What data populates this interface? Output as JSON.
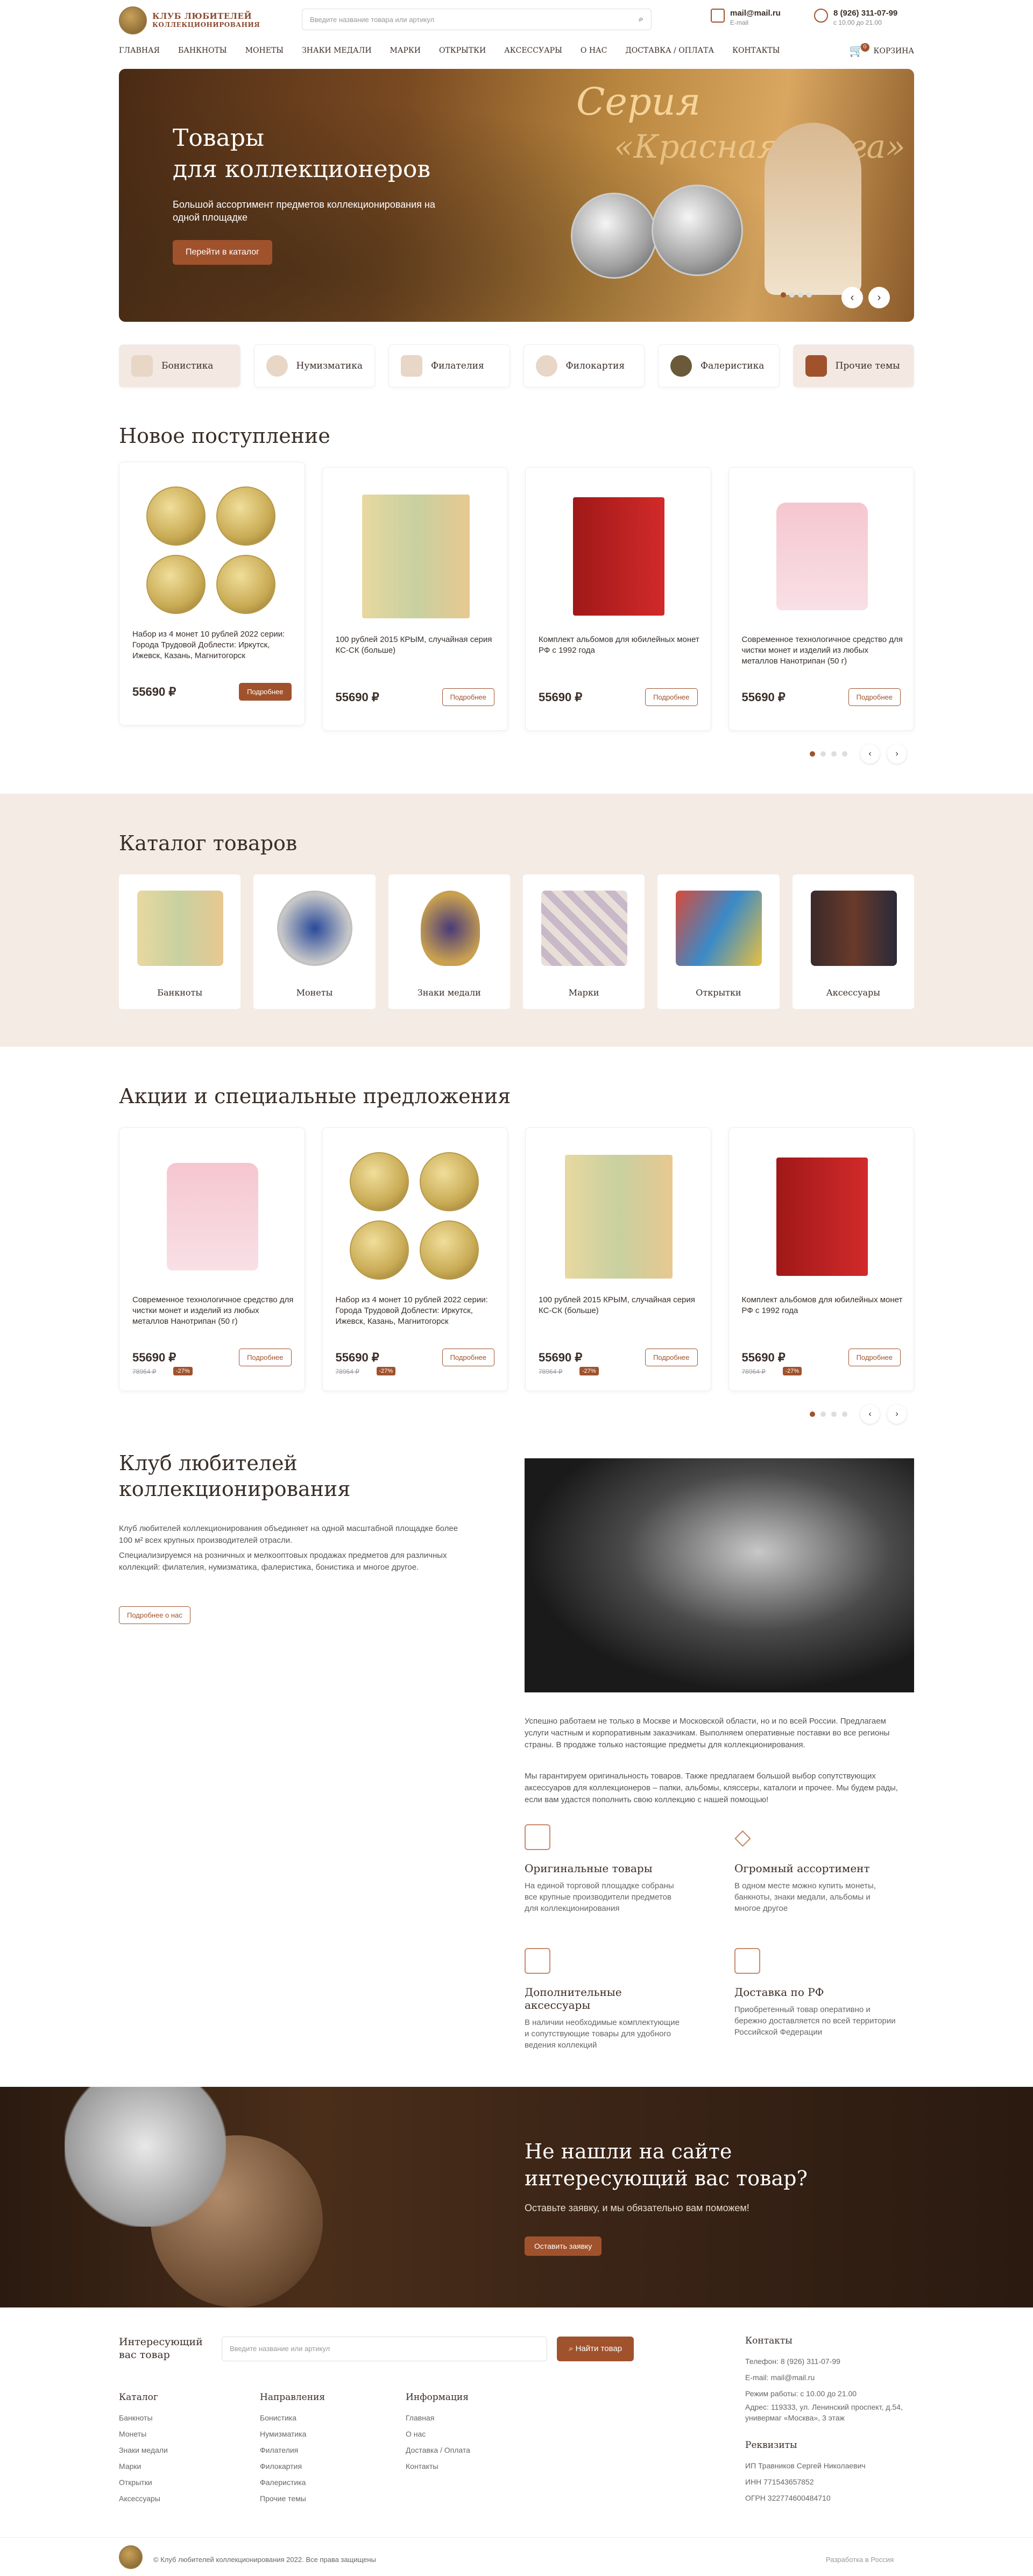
{
  "header": {
    "logo_line1": "КЛУБ ЛЮБИТЕЛЕЙ",
    "logo_line2": "КОЛЛЕКЦИОНИРОВАНИЯ",
    "search_placeholder": "Введите название товара или артикул",
    "email": "mail@mail.ru",
    "email_label": "E-mail",
    "phone": "8 (926) 311-07-99",
    "hours": "с 10.00 до 21.00",
    "cart_label": "КОРЗИНА",
    "cart_count": "0"
  },
  "nav": [
    "ГЛАВНАЯ",
    "БАНКНОТЫ",
    "МОНЕТЫ",
    "ЗНАКИ МЕДАЛИ",
    "МАРКИ",
    "ОТКРЫТКИ",
    "АКСЕССУАРЫ",
    "О НАС",
    "ДОСТАВКА / ОПЛАТА",
    "КОНТАКТЫ"
  ],
  "hero": {
    "title_line1": "Товары",
    "title_line2": "для коллекционеров",
    "subtitle": "Большой ассортимент предметов коллекционирования на одной площадке",
    "button": "Перейти в каталог",
    "overlay1": "Серия",
    "overlay2": "«Красная книга»"
  },
  "tabs": [
    "Бонистика",
    "Нумизматика",
    "Филателия",
    "Филокартия",
    "Фалеристика",
    "Прочие темы"
  ],
  "new_arrivals": {
    "title": "Новое поступление",
    "items": [
      {
        "title": "Набор из 4 монет 10 рублей 2022 серии: Города Трудовой Доблести: Иркутск, Ижевск, Казань, Магнитогорск",
        "price": "55690 ₽",
        "button": "Подробнее"
      },
      {
        "title": "100 рублей 2015 КРЫМ, случайная серия КС-СК (больше)",
        "price": "55690 ₽",
        "button": "Подробнее"
      },
      {
        "title": "Комплект альбомов для юбилейных монет РФ с 1992 года",
        "price": "55690 ₽",
        "button": "Подробнее"
      },
      {
        "title": "Современное технологичное средство для чистки монет и изделий из любых металлов Нанотрипан (50 г)",
        "price": "55690 ₽",
        "button": "Подробнее"
      }
    ]
  },
  "catalog": {
    "title": "Каталог товаров",
    "items": [
      "Банкноты",
      "Монеты",
      "Знаки медали",
      "Марки",
      "Открытки",
      "Аксессуары"
    ]
  },
  "promo": {
    "title": "Акции и специальные предложения",
    "items": [
      {
        "title": "Современное технологичное средство для чистки монет и изделий из любых металлов Нанотрипан (50 г)",
        "price": "55690 ₽",
        "old": "78964 ₽",
        "disc": "-27%",
        "button": "Подробнее"
      },
      {
        "title": "Набор из 4 монет 10 рублей 2022 серии: Города Трудовой Доблести: Иркутск, Ижевск, Казань, Магнитогорск",
        "price": "55690 ₽",
        "old": "78964 ₽",
        "disc": "-27%",
        "button": "Подробнее"
      },
      {
        "title": "100 рублей 2015 КРЫМ, случайная серия КС-СК (больше)",
        "price": "55690 ₽",
        "old": "78964 ₽",
        "disc": "-27%",
        "button": "Подробнее"
      },
      {
        "title": "Комплект альбомов для юбилейных монет РФ с 1992 года",
        "price": "55690 ₽",
        "old": "78964 ₽",
        "disc": "-27%",
        "button": "Подробнее"
      }
    ]
  },
  "club": {
    "title_line1": "Клуб любителей",
    "title_line2": "коллекционирования",
    "p1": "Клуб любителей коллекционирования объединяет на одной масштабной площадке более 100 м² всех крупных производителей отрасли.",
    "p2": "Специализируемся на розничных и мелкооптовых продажах предметов для различных коллекций: филателия, нумизматика, фалеристика, бонистика и многое другое.",
    "button": "Подробнее о нас",
    "p3": "Успешно работаем не только в Москве и Московской области, но и по всей России. Предлагаем услуги частным и корпоративным заказчикам. Выполняем оперативные поставки во все регионы страны. В продаже только настоящие предметы для коллекционирования.",
    "p4": "Мы гарантируем оригинальность товаров. Также предлагаем большой выбор сопутствующих аксессуаров для коллекционеров – папки, альбомы, кляссеры, каталоги и прочее. Мы будем рады, если вам удастся пополнить свою коллекцию с нашей помощью!",
    "features": [
      {
        "title": "Оригинальные товары",
        "text": "На единой торговой площадке собраны все крупные производители предметов для коллекционирования"
      },
      {
        "title": "Огромный ассортимент",
        "text": "В одном месте можно купить монеты, банкноты, знаки медали, альбомы и многое другое"
      },
      {
        "title": "Дополнительные аксессуары",
        "text": "В наличии необходимые комплектующие и сопутствующие товары для удобного ведения коллекций"
      },
      {
        "title": "Доставка по РФ",
        "text": "Приобретенный товар оперативно и бережно доставляется по всей территории Российской Федерации"
      }
    ]
  },
  "banner": {
    "title_line1": "Не нашли на сайте",
    "title_line2": "интересующий вас товар?",
    "subtitle": "Оставьте заявку, и мы обязательно вам поможем!",
    "button": "Оставить заявку"
  },
  "footer": {
    "search_title_line1": "Интересующий",
    "search_title_line2": "вас товар",
    "search_placeholder": "Введите название или артикул",
    "search_button": "Найти товар",
    "col1": {
      "title": "Каталог",
      "items": [
        "Банкноты",
        "Монеты",
        "Знаки медали",
        "Марки",
        "Открытки",
        "Аксессуары"
      ]
    },
    "col2": {
      "title": "Направления",
      "items": [
        "Бонистика",
        "Нумизматика",
        "Филателия",
        "Филокартия",
        "Фалеристика",
        "Прочие темы"
      ]
    },
    "col3": {
      "title": "Информация",
      "items": [
        "Главная",
        "О нас",
        "Доставка / Оплата",
        "Контакты"
      ]
    },
    "contacts": {
      "title": "Контакты",
      "items": [
        "Телефон: 8 (926) 311-07-99",
        "E-mail: mail@mail.ru",
        "Режим работы: с 10.00 до 21.00",
        "Адрес: 119333, ул. Ленинский проспект, д.54, универмаг «Москва», 3 этаж"
      ]
    },
    "requisites": {
      "title": "Реквизиты",
      "items": [
        "ИП Травников Сергей Николаевич",
        "ИНН 771543657852",
        "ОГРН 322774600484710"
      ]
    },
    "copyright": "© Клуб любителей коллекционирования 2022. Все права защищены",
    "dev": "Разработка в Россия"
  }
}
